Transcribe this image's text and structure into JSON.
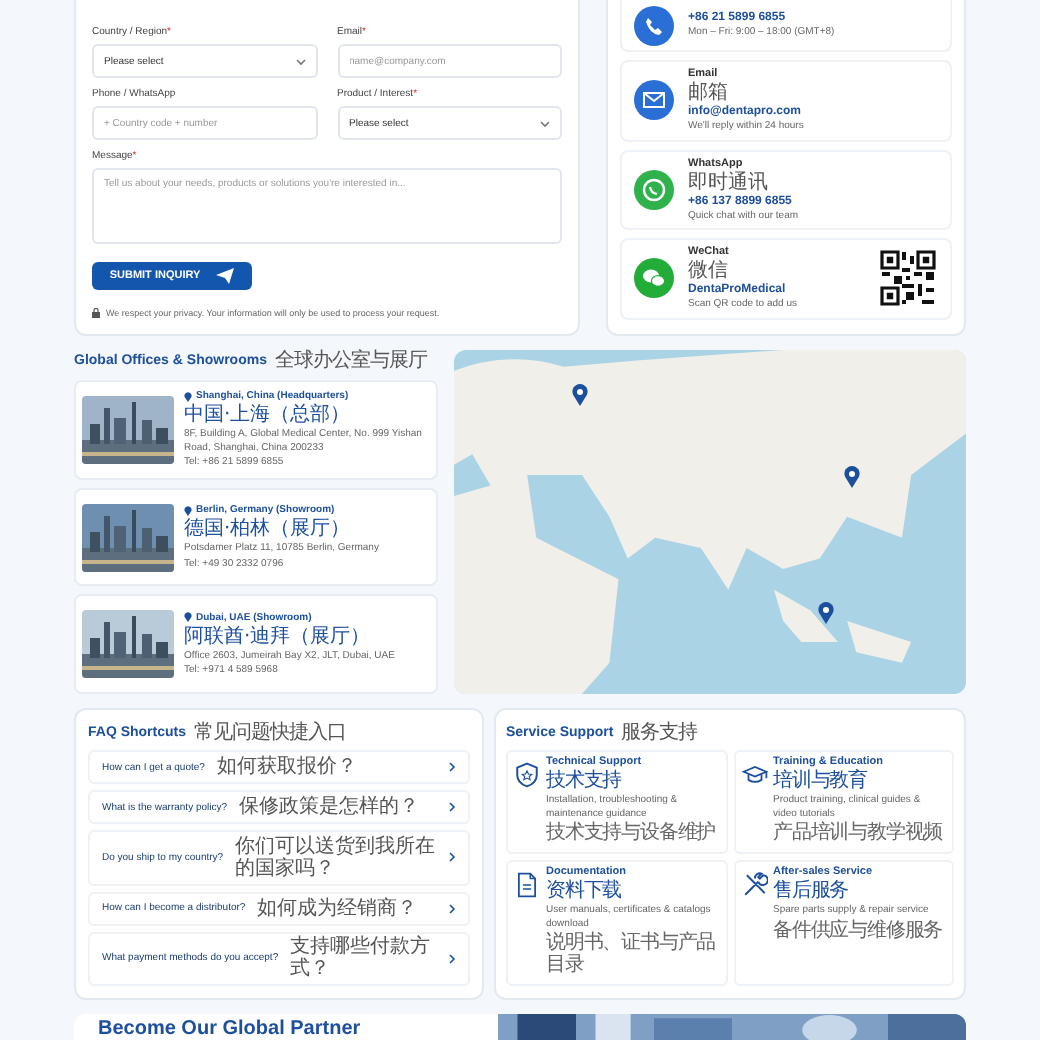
{
  "inquiry_form": {
    "fields": [
      {
        "label": "Country / Region",
        "required_mark": "*",
        "kind": "select",
        "placeholder": "Please select"
      },
      {
        "label": "Email",
        "required_mark": "*",
        "kind": "input",
        "placeholder": "name@company.com"
      },
      {
        "label": "Phone / WhatsApp",
        "kind": "input",
        "placeholder": "+ Country code + number"
      },
      {
        "label": "Product / Interest",
        "required_mark": "*",
        "kind": "select",
        "placeholder": "Please select"
      },
      {
        "label": "Message",
        "required_mark": "*",
        "kind": "textarea",
        "placeholder": "Tell us about your needs, products or solutions you're interested in..."
      }
    ],
    "submit_button": "SUBMIT INQUIRY",
    "privacy_note": "We respect your privacy. Your information will only be used to process your request."
  },
  "contacts": [
    {
      "kind": "phone",
      "value": "+86 21 5899 6855",
      "note": "Mon – Fri: 9:00 – 18:00 (GMT+8)"
    },
    {
      "kind": "email",
      "title": "Email",
      "title_zh": "邮箱",
      "value": "info@dentapro.com",
      "note": "We'll reply within 24 hours"
    },
    {
      "kind": "whatsapp",
      "title": "WhatsApp",
      "title_zh": "即时通讯",
      "value": "+86 137 8899 6855",
      "note": "Quick chat with our team"
    },
    {
      "kind": "wechat",
      "title": "WeChat",
      "title_zh": "微信",
      "value": "DentaProMedical",
      "note": "Scan QR code to add us"
    }
  ],
  "offices": {
    "title": "Global Offices & Showrooms",
    "title_zh": "全球办公室与展厅",
    "items": [
      {
        "name": "Shanghai, China (Headquarters)",
        "name_zh": "中国·上海（总部）",
        "address": "8F, Building A, Global Medical Center, No. 999 Yishan Road, Shanghai, China 200233",
        "tel": "Tel: +86 21 5899 6855"
      },
      {
        "name": "Berlin, Germany (Showroom)",
        "name_zh": "德国·柏林（展厅）",
        "address": "Potsdamer Platz 11, 10785 Berlin, Germany",
        "tel": "Tel: +49 30 2332 0796"
      },
      {
        "name": "Dubai, UAE (Showroom)",
        "name_zh": "阿联酋·迪拜（展厅）",
        "address": "Office 2603, Jumeirah Bay X2, JLT, Dubai, UAE",
        "tel": "Tel: +971 4 589 5968"
      }
    ]
  },
  "faq": {
    "title": "FAQ Shortcuts",
    "title_zh": "常见问题快捷入口",
    "items": [
      {
        "question": "How can I get a quote?",
        "question_zh": "如何获取报价？"
      },
      {
        "question": "What is the warranty policy?",
        "question_zh": "保修政策是怎样的？"
      },
      {
        "question": "Do you ship to my country?",
        "question_zh": "你们可以送货到我所在的国家吗？"
      },
      {
        "question": "How can I become a distributor?",
        "question_zh": "如何成为经销商？"
      },
      {
        "question": "What payment methods do you accept?",
        "question_zh": "支持哪些付款方式？"
      }
    ]
  },
  "service_support": {
    "title": "Service Support",
    "title_zh": "服务支持",
    "items": [
      {
        "kind": "shield",
        "title": "Technical Support",
        "title_zh": "技术支持",
        "description": "Installation, troubleshooting & maintenance guidance",
        "description_zh": "技术支持与设备维护"
      },
      {
        "kind": "cap",
        "title": "Training & Education",
        "title_zh": "培训与教育",
        "description": "Product training, clinical guides & video tutorials",
        "description_zh": "产品培训与教学视频"
      },
      {
        "kind": "document",
        "title": "Documentation",
        "title_zh": "资料下载",
        "description": "User manuals, certificates & catalogs download",
        "description_zh": "说明书、证书与产品目录"
      },
      {
        "kind": "tools",
        "title": "After-sales Service",
        "title_zh": "售后服务",
        "description": "Spare parts supply & repair service",
        "description_zh": "备件供应与维修服务"
      }
    ]
  },
  "partner_banner": {
    "title": "Become Our Global Partner"
  }
}
